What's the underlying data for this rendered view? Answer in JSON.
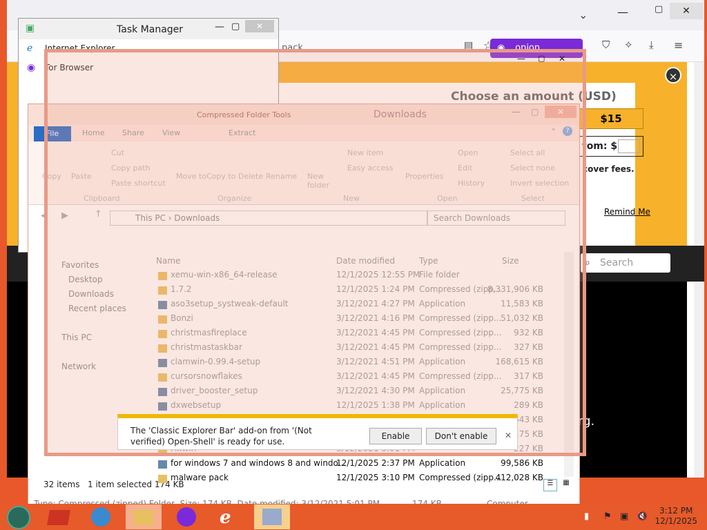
{
  "browser": {
    "tab_title": "pack",
    "onion_label": ".onion available",
    "donation": {
      "title": "Choose an amount (USD)",
      "amount_button": "$15",
      "custom_label": "tom: $",
      "cover_fees": "cover fees.",
      "remind_me": "Remind Me"
    },
    "search_placeholder": "Search",
    "org_text": "org."
  },
  "taskmanager": {
    "title": "Task Manager",
    "items": [
      "Internet Explorer",
      "Tor Browser"
    ]
  },
  "explorer": {
    "window_title": "Downloads",
    "context_tab": "Compressed Folder Tools",
    "tabs": [
      "File",
      "Home",
      "Share",
      "View",
      "Extract"
    ],
    "ribbon": {
      "copy": "Copy",
      "paste": "Paste",
      "cut": "Cut",
      "copy_path": "Copy path",
      "paste_shortcut": "Paste shortcut",
      "move_to": "Move to",
      "copy_to": "Copy to",
      "delete": "Delete",
      "rename": "Rename",
      "new_folder": "New folder",
      "new_item": "New item",
      "easy_access": "Easy access",
      "properties": "Properties",
      "open": "Open",
      "edit": "Edit",
      "history": "History",
      "select_all": "Select all",
      "select_none": "Select none",
      "invert_selection": "Invert selection",
      "groups": [
        "Clipboard",
        "Organize",
        "New",
        "Open",
        "Select"
      ]
    },
    "path": [
      "This PC",
      "Downloads"
    ],
    "search_placeholder": "Search Downloads",
    "nav": [
      "Favorites",
      "Desktop",
      "Downloads",
      "Recent places",
      "This PC",
      "Network"
    ],
    "columns": [
      "Name",
      "Date modified",
      "Type",
      "Size"
    ],
    "rows": [
      {
        "name": "xemu-win-x86_64-release",
        "date": "12/1/2025 12:55 PM",
        "type": "File folder",
        "size": ""
      },
      {
        "name": "1.7.2",
        "date": "12/1/2025 1:24 PM",
        "type": "Compressed (zipp...",
        "size": "8,331,906 KB"
      },
      {
        "name": "aso3setup_systweak-default",
        "date": "3/12/2021 4:27 PM",
        "type": "Application",
        "size": "11,583 KB"
      },
      {
        "name": "Bonzi",
        "date": "3/12/2021 4:16 PM",
        "type": "Compressed (zipp...",
        "size": "51,032 KB"
      },
      {
        "name": "christmasfireplace",
        "date": "3/12/2021 4:45 PM",
        "type": "Compressed (zipp...",
        "size": "932 KB"
      },
      {
        "name": "christmastaskbar",
        "date": "3/12/2021 4:45 PM",
        "type": "Compressed (zipp...",
        "size": "327 KB"
      },
      {
        "name": "clamwin-0.99.4-setup",
        "date": "3/12/2021 4:51 PM",
        "type": "Application",
        "size": "168,615 KB"
      },
      {
        "name": "cursorsnowflakes",
        "date": "3/12/2021 4:45 PM",
        "type": "Compressed (zipp...",
        "size": "317 KB"
      },
      {
        "name": "driver_booster_setup",
        "date": "3/12/2021 4:30 PM",
        "type": "Application",
        "size": "25,775 KB"
      },
      {
        "name": "dxwebsetup",
        "date": "12/1/2025 1:38 PM",
        "type": "Application",
        "size": "289 KB"
      },
      {
        "name": "fastvd_bc",
        "date": "3/12/2021 4:42 PM",
        "type": "Application",
        "size": "5,643 KB"
      },
      {
        "name": "",
        "date": "3/12/2021",
        "type": "",
        "size": "175 KB"
      },
      {
        "name": "Fixwin",
        "date": "3/12/2021 5:01 PM",
        "type": "",
        "size": "227 KB"
      },
      {
        "name": "for windows 7 and windows 8 and windo...",
        "date": "12/1/2025 2:37 PM",
        "type": "Application",
        "size": "99,586 KB"
      },
      {
        "name": "malware pack",
        "date": "12/1/2025 3:10 PM",
        "type": "Compressed (zipp...",
        "size": "412,028 KB"
      }
    ],
    "status": {
      "items": "32 items",
      "selected": "1 item selected  174 KB"
    },
    "details": {
      "text": "Type: Compressed (zipped) Folder, Size: 174 KB, Date modified: 3/12/2021 5:01 PM",
      "size": "174 KB",
      "location": "Computer"
    }
  },
  "popup": {
    "message": "The 'Classic Explorer Bar' add-on from '(Not verified) Open-Shell' is ready for use.",
    "enable": "Enable",
    "dont_enable": "Don't enable"
  },
  "tray": {
    "time": "3:12 PM",
    "date": "12/1/2025"
  }
}
